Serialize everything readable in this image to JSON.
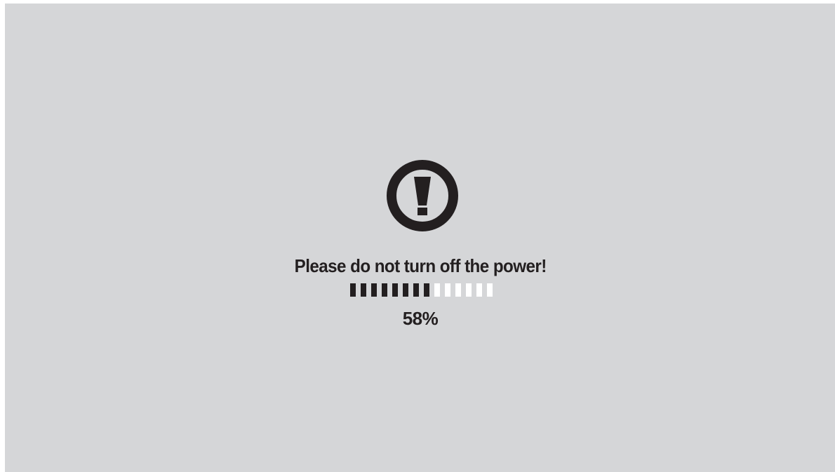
{
  "colors": {
    "background": "#d5d6d8",
    "foreground": "#231f20",
    "segment_empty": "#ffffff"
  },
  "icon": "exclamation-circle-icon",
  "message": "Please do not turn off the power!",
  "progress": {
    "value_percent": 58,
    "total_segments": 14,
    "filled_segments": 8
  },
  "percent_label": "58%"
}
